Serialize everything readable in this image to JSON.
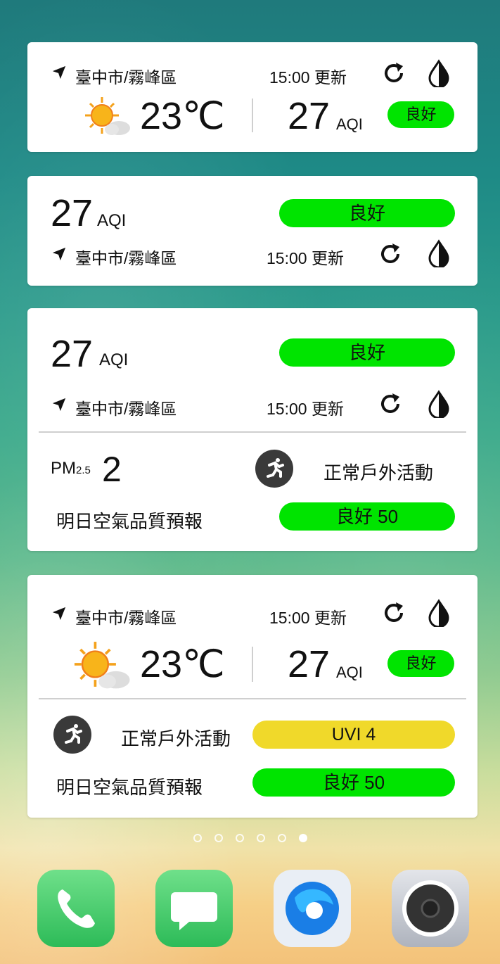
{
  "location": "臺中市/霧峰區",
  "update_time": "15:00 更新",
  "temperature": "23℃",
  "aqi_value": "27",
  "aqi_unit": "AQI",
  "aqi_status": "良好",
  "pm25_label": "PM",
  "pm25_sub": "2.5",
  "pm25_value": "2",
  "activity": "正常戶外活動",
  "forecast_label": "明日空氣品質預報",
  "forecast_value": "良好 50",
  "uvi": "UVI 4",
  "colors": {
    "good": "#00e400",
    "uvi": "#f0d92a"
  },
  "icons": [
    "location-arrow-icon",
    "refresh-icon",
    "contrast-icon",
    "sun-cloud-icon",
    "runner-icon",
    "phone-icon",
    "message-icon",
    "browser-icon",
    "camera-icon"
  ],
  "pager": {
    "count": 6,
    "active": 6
  }
}
